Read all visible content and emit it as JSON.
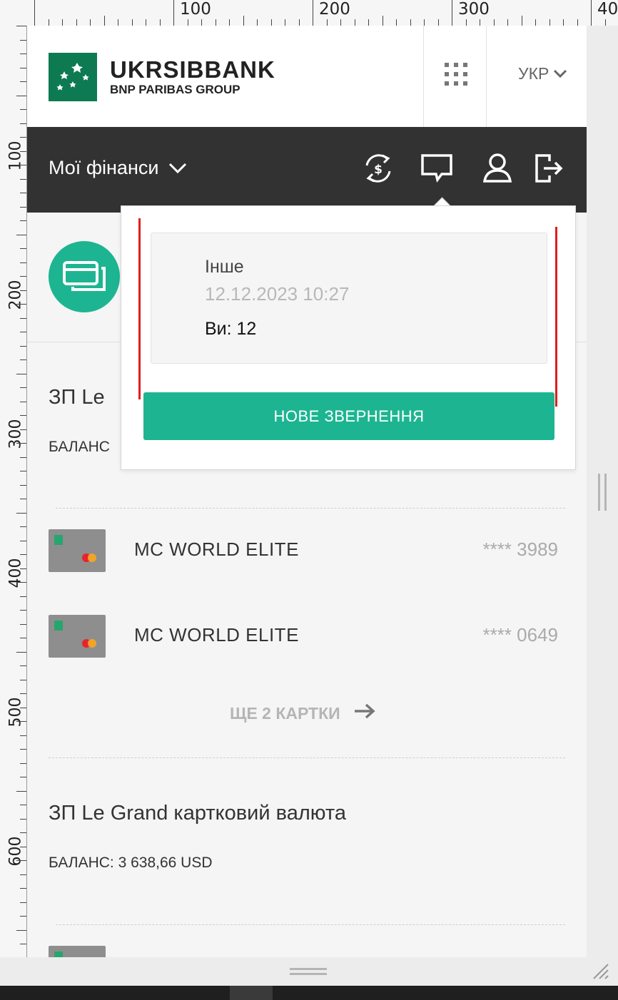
{
  "ruler": {
    "top_labels": [
      "100",
      "200",
      "300",
      "40"
    ],
    "left_labels": [
      "100",
      "200",
      "300",
      "400",
      "500",
      "600"
    ]
  },
  "header": {
    "brand_name": "UKRSIBBANK",
    "brand_sub": "BNP PARIBAS GROUP",
    "language": "УКР"
  },
  "nav": {
    "title": "Мої фінанси",
    "icons": [
      "currency-exchange-icon",
      "chat-icon",
      "user-icon",
      "logout-icon"
    ]
  },
  "popup": {
    "message": {
      "topic": "Інше",
      "date": "12.12.2023 10:27",
      "preview": "Ви: 12"
    },
    "new_button": "НОВЕ ЗВЕРНЕННЯ"
  },
  "accounts": [
    {
      "title": "ЗП Le",
      "balance": "БАЛАНС",
      "cards": [
        {
          "name": "MC WORLD ELITE",
          "number": "**** 3989"
        },
        {
          "name": "MC WORLD ELITE",
          "number": "**** 0649"
        }
      ],
      "more": "ЩЕ 2 КАРТКИ"
    },
    {
      "title": "ЗП Le Grand картковий валюта",
      "balance": "БАЛАНС: 3 638,66 USD"
    }
  ],
  "colors": {
    "accent": "#1db591",
    "nav_bg": "#323232",
    "logo_green": "#0d7a52",
    "highlight": "#e01e1e"
  }
}
